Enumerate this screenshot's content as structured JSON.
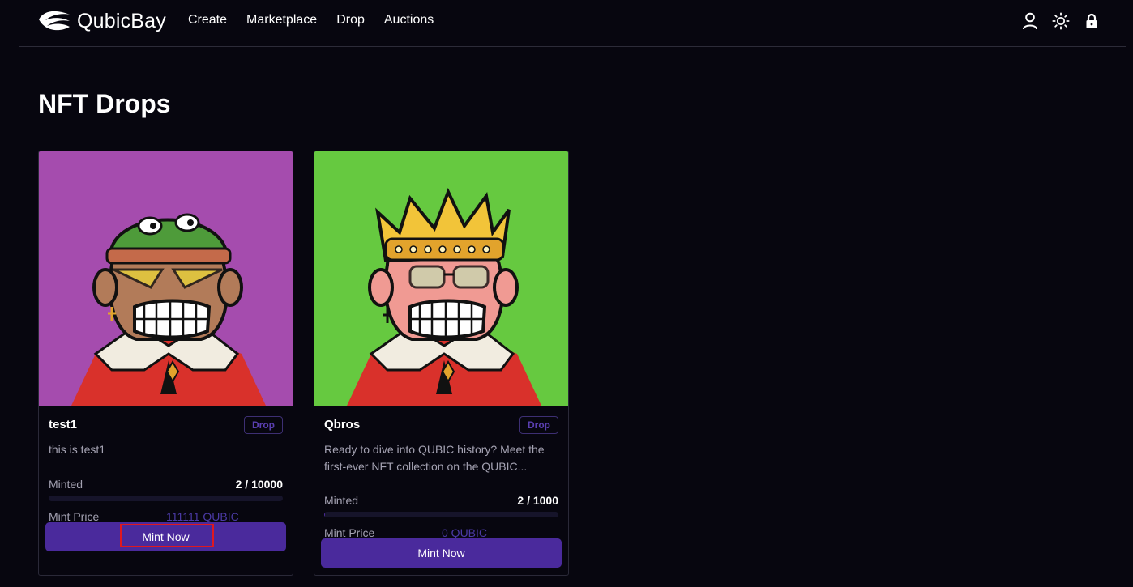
{
  "header": {
    "brand": "QubicBay",
    "nav": [
      "Create",
      "Marketplace",
      "Drop",
      "Auctions"
    ],
    "icons": [
      "user-icon",
      "sun-icon",
      "lock-icon"
    ]
  },
  "page": {
    "title": "NFT Drops"
  },
  "drops": [
    {
      "title": "test1",
      "badge": "Drop",
      "description": "this is test1",
      "minted_label": "Minted",
      "minted_value": "2 / 10000",
      "minted_fraction": 0.0002,
      "price_label": "Mint Price",
      "price_value": "111111 QUBIC",
      "button_label": "Mint Now",
      "art_background": "#a54cae"
    },
    {
      "title": "Qbros",
      "badge": "Drop",
      "description": "Ready to dive into QUBIC history? Meet the first-ever NFT collection on the QUBIC...",
      "minted_label": "Minted",
      "minted_value": "2 / 1000",
      "minted_fraction": 0.002,
      "price_label": "Mint Price",
      "price_value": "0 QUBIC",
      "button_label": "Mint Now",
      "art_background": "#66c940"
    }
  ],
  "colors": {
    "background": "#07060f",
    "accent": "#4a2a9c",
    "highlight_outline": "#e0181f"
  }
}
